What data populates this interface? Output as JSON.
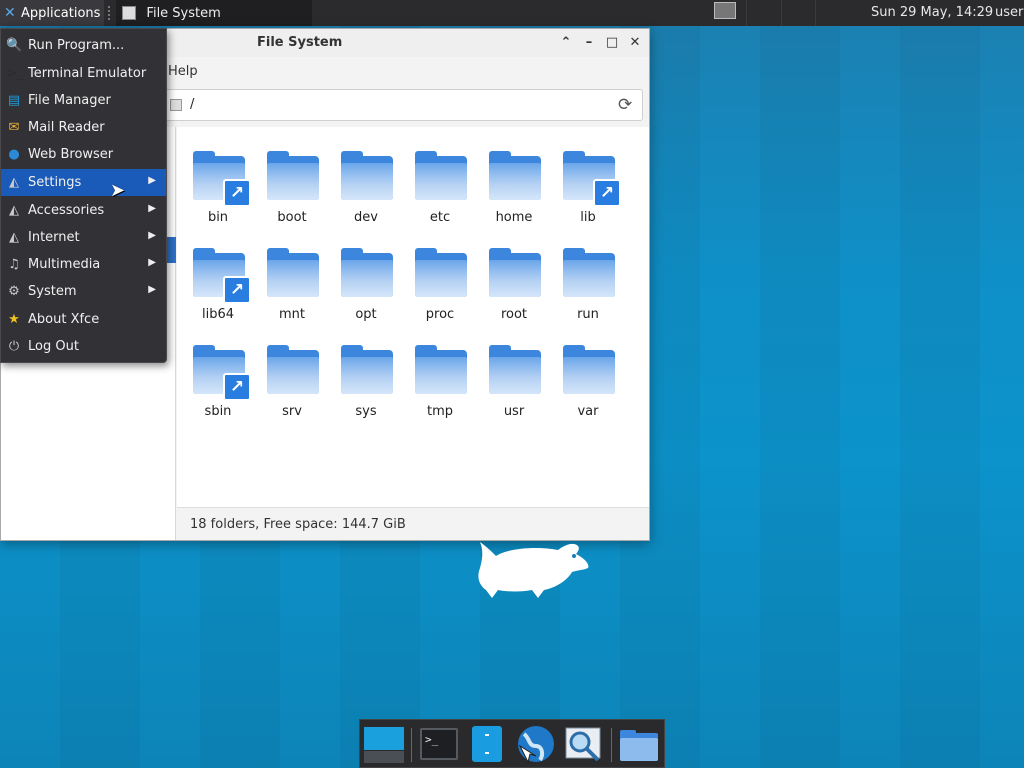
{
  "panel": {
    "applications_label": "Applications",
    "task_title": "File System",
    "clock": "Sun 29 May, 14:29",
    "user": "user"
  },
  "window": {
    "title": "File System",
    "menu_help": "Help",
    "path": "/",
    "status": "18 folders, Free space: 144.7 GiB"
  },
  "folders": [
    {
      "name": "bin",
      "link": true
    },
    {
      "name": "boot",
      "link": false
    },
    {
      "name": "dev",
      "link": false
    },
    {
      "name": "etc",
      "link": false
    },
    {
      "name": "home",
      "link": false
    },
    {
      "name": "lib",
      "link": true
    },
    {
      "name": "lib64",
      "link": true
    },
    {
      "name": "mnt",
      "link": false
    },
    {
      "name": "opt",
      "link": false
    },
    {
      "name": "proc",
      "link": false
    },
    {
      "name": "root",
      "link": false
    },
    {
      "name": "run",
      "link": false
    },
    {
      "name": "sbin",
      "link": true
    },
    {
      "name": "srv",
      "link": false
    },
    {
      "name": "sys",
      "link": false
    },
    {
      "name": "tmp",
      "link": false
    },
    {
      "name": "usr",
      "link": false
    },
    {
      "name": "var",
      "link": false
    }
  ],
  "apps_menu": {
    "items": [
      {
        "label": "Run Program...",
        "icon": "run-icon",
        "submenu": false
      },
      {
        "label": "Terminal Emulator",
        "icon": "terminal-icon",
        "submenu": false
      },
      {
        "label": "File Manager",
        "icon": "file-manager-icon",
        "submenu": false
      },
      {
        "label": "Mail Reader",
        "icon": "mail-icon",
        "submenu": false
      },
      {
        "label": "Web Browser",
        "icon": "globe-icon",
        "submenu": false
      },
      {
        "label": "Settings",
        "icon": "settings-icon",
        "submenu": true,
        "active": true
      },
      {
        "label": "Accessories",
        "icon": "accessories-icon",
        "submenu": true
      },
      {
        "label": "Internet",
        "icon": "internet-icon",
        "submenu": true
      },
      {
        "label": "Multimedia",
        "icon": "multimedia-icon",
        "submenu": true
      },
      {
        "label": "System",
        "icon": "system-gear-icon",
        "submenu": true
      },
      {
        "label": "About Xfce",
        "icon": "star-icon",
        "submenu": false
      },
      {
        "label": "Log Out",
        "icon": "logout-icon",
        "submenu": false
      }
    ]
  },
  "dock": {
    "items": [
      "show-desktop-icon",
      "terminal-icon",
      "file-manager-icon",
      "web-browser-icon",
      "app-finder-icon",
      "folder-icon"
    ]
  },
  "colors": {
    "accent": "#1a5ab8",
    "folder": "#3d86dd",
    "desktop": "#0f8fc7"
  }
}
